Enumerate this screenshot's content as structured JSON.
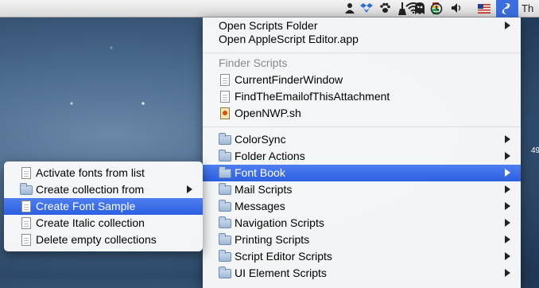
{
  "menubar": {
    "clipped_text": "Th",
    "icons": [
      "user-icon",
      "dropbox-icon",
      "paw-icon",
      "broom-icon",
      "ghost-icon",
      "battery-meter-icon",
      "wifi-icon",
      "time-machine-icon",
      "volume-icon",
      "us-flag-icon",
      "script-menu-icon"
    ]
  },
  "desktop": {
    "clipped_label": "49"
  },
  "main_menu": {
    "top_items": [
      {
        "label": "Open Scripts Folder",
        "submenu": true
      },
      {
        "label": "Open AppleScript Editor.app",
        "submenu": false
      }
    ],
    "finder_header": "Finder Scripts",
    "finder_items": [
      {
        "label": "CurrentFinderWindow",
        "icon": "script-file-icon"
      },
      {
        "label": "FindTheEmailofThisAttachment",
        "icon": "script-file-icon"
      },
      {
        "label": "OpenNWP.sh",
        "icon": "shell-script-icon"
      }
    ],
    "folders": [
      {
        "label": "ColorSync",
        "selected": false
      },
      {
        "label": "Folder Actions",
        "selected": false
      },
      {
        "label": "Font Book",
        "selected": true
      },
      {
        "label": "Mail Scripts",
        "selected": false
      },
      {
        "label": "Messages",
        "selected": false
      },
      {
        "label": "Navigation Scripts",
        "selected": false
      },
      {
        "label": "Printing Scripts",
        "selected": false
      },
      {
        "label": "Script Editor Scripts",
        "selected": false
      },
      {
        "label": "UI Element Scripts",
        "selected": false
      }
    ]
  },
  "sub_menu": {
    "items": [
      {
        "label": "Activate fonts from list",
        "icon": "script-file-icon",
        "submenu": false,
        "selected": false
      },
      {
        "label": "Create collection from",
        "icon": "folder-icon",
        "submenu": true,
        "selected": false
      },
      {
        "label": "Create Font Sample",
        "icon": "script-file-icon",
        "submenu": false,
        "selected": true
      },
      {
        "label": "Create Italic collection",
        "icon": "script-file-icon",
        "submenu": false,
        "selected": false
      },
      {
        "label": "Delete empty collections",
        "icon": "script-file-icon",
        "submenu": false,
        "selected": false
      }
    ]
  },
  "colors": {
    "selection": "#3c6fde",
    "menu_bg": "#fafafa",
    "header_text": "#8a8a8a"
  }
}
